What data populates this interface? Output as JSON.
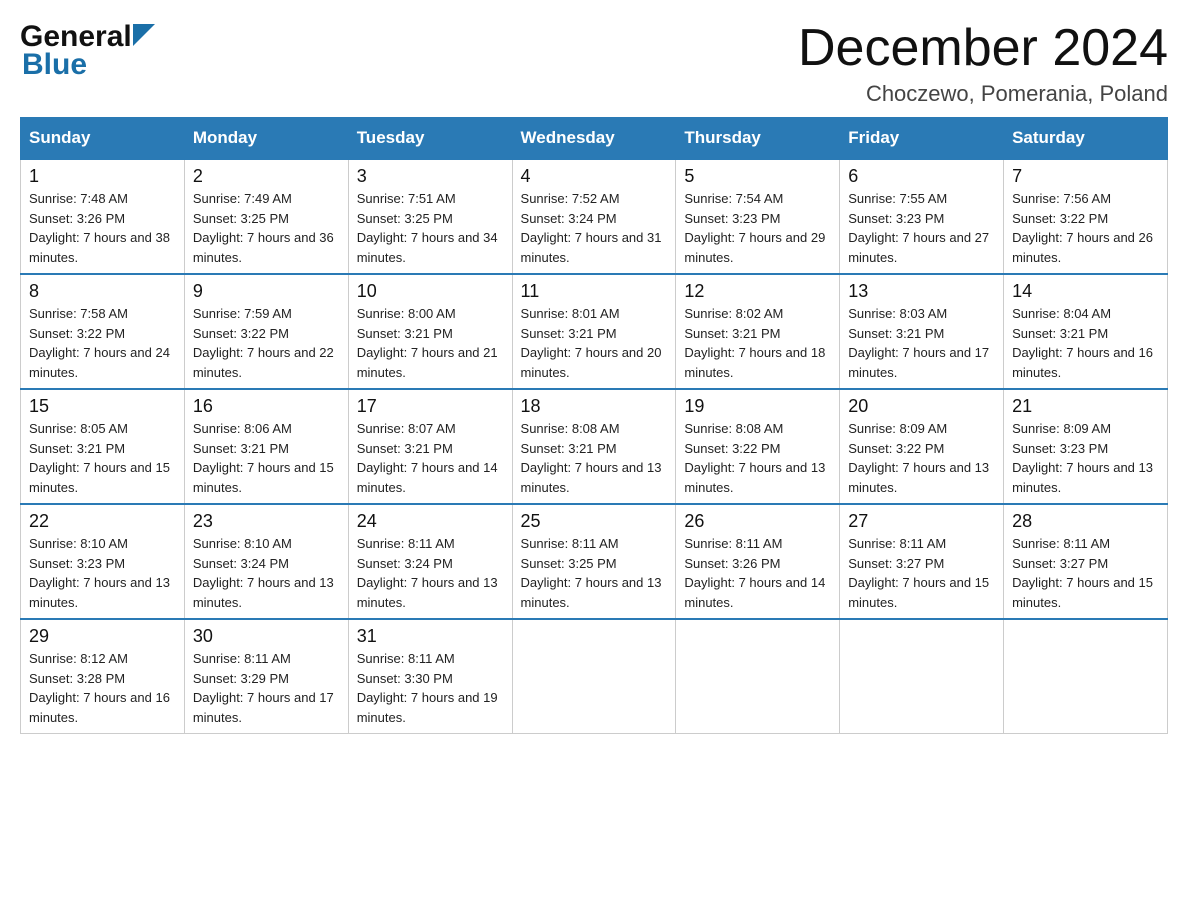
{
  "header": {
    "logo_general": "General",
    "logo_blue": "Blue",
    "month_title": "December 2024",
    "location": "Choczewo, Pomerania, Poland"
  },
  "days_of_week": [
    "Sunday",
    "Monday",
    "Tuesday",
    "Wednesday",
    "Thursday",
    "Friday",
    "Saturday"
  ],
  "weeks": [
    [
      {
        "day": "1",
        "sunrise": "Sunrise: 7:48 AM",
        "sunset": "Sunset: 3:26 PM",
        "daylight": "Daylight: 7 hours and 38 minutes."
      },
      {
        "day": "2",
        "sunrise": "Sunrise: 7:49 AM",
        "sunset": "Sunset: 3:25 PM",
        "daylight": "Daylight: 7 hours and 36 minutes."
      },
      {
        "day": "3",
        "sunrise": "Sunrise: 7:51 AM",
        "sunset": "Sunset: 3:25 PM",
        "daylight": "Daylight: 7 hours and 34 minutes."
      },
      {
        "day": "4",
        "sunrise": "Sunrise: 7:52 AM",
        "sunset": "Sunset: 3:24 PM",
        "daylight": "Daylight: 7 hours and 31 minutes."
      },
      {
        "day": "5",
        "sunrise": "Sunrise: 7:54 AM",
        "sunset": "Sunset: 3:23 PM",
        "daylight": "Daylight: 7 hours and 29 minutes."
      },
      {
        "day": "6",
        "sunrise": "Sunrise: 7:55 AM",
        "sunset": "Sunset: 3:23 PM",
        "daylight": "Daylight: 7 hours and 27 minutes."
      },
      {
        "day": "7",
        "sunrise": "Sunrise: 7:56 AM",
        "sunset": "Sunset: 3:22 PM",
        "daylight": "Daylight: 7 hours and 26 minutes."
      }
    ],
    [
      {
        "day": "8",
        "sunrise": "Sunrise: 7:58 AM",
        "sunset": "Sunset: 3:22 PM",
        "daylight": "Daylight: 7 hours and 24 minutes."
      },
      {
        "day": "9",
        "sunrise": "Sunrise: 7:59 AM",
        "sunset": "Sunset: 3:22 PM",
        "daylight": "Daylight: 7 hours and 22 minutes."
      },
      {
        "day": "10",
        "sunrise": "Sunrise: 8:00 AM",
        "sunset": "Sunset: 3:21 PM",
        "daylight": "Daylight: 7 hours and 21 minutes."
      },
      {
        "day": "11",
        "sunrise": "Sunrise: 8:01 AM",
        "sunset": "Sunset: 3:21 PM",
        "daylight": "Daylight: 7 hours and 20 minutes."
      },
      {
        "day": "12",
        "sunrise": "Sunrise: 8:02 AM",
        "sunset": "Sunset: 3:21 PM",
        "daylight": "Daylight: 7 hours and 18 minutes."
      },
      {
        "day": "13",
        "sunrise": "Sunrise: 8:03 AM",
        "sunset": "Sunset: 3:21 PM",
        "daylight": "Daylight: 7 hours and 17 minutes."
      },
      {
        "day": "14",
        "sunrise": "Sunrise: 8:04 AM",
        "sunset": "Sunset: 3:21 PM",
        "daylight": "Daylight: 7 hours and 16 minutes."
      }
    ],
    [
      {
        "day": "15",
        "sunrise": "Sunrise: 8:05 AM",
        "sunset": "Sunset: 3:21 PM",
        "daylight": "Daylight: 7 hours and 15 minutes."
      },
      {
        "day": "16",
        "sunrise": "Sunrise: 8:06 AM",
        "sunset": "Sunset: 3:21 PM",
        "daylight": "Daylight: 7 hours and 15 minutes."
      },
      {
        "day": "17",
        "sunrise": "Sunrise: 8:07 AM",
        "sunset": "Sunset: 3:21 PM",
        "daylight": "Daylight: 7 hours and 14 minutes."
      },
      {
        "day": "18",
        "sunrise": "Sunrise: 8:08 AM",
        "sunset": "Sunset: 3:21 PM",
        "daylight": "Daylight: 7 hours and 13 minutes."
      },
      {
        "day": "19",
        "sunrise": "Sunrise: 8:08 AM",
        "sunset": "Sunset: 3:22 PM",
        "daylight": "Daylight: 7 hours and 13 minutes."
      },
      {
        "day": "20",
        "sunrise": "Sunrise: 8:09 AM",
        "sunset": "Sunset: 3:22 PM",
        "daylight": "Daylight: 7 hours and 13 minutes."
      },
      {
        "day": "21",
        "sunrise": "Sunrise: 8:09 AM",
        "sunset": "Sunset: 3:23 PM",
        "daylight": "Daylight: 7 hours and 13 minutes."
      }
    ],
    [
      {
        "day": "22",
        "sunrise": "Sunrise: 8:10 AM",
        "sunset": "Sunset: 3:23 PM",
        "daylight": "Daylight: 7 hours and 13 minutes."
      },
      {
        "day": "23",
        "sunrise": "Sunrise: 8:10 AM",
        "sunset": "Sunset: 3:24 PM",
        "daylight": "Daylight: 7 hours and 13 minutes."
      },
      {
        "day": "24",
        "sunrise": "Sunrise: 8:11 AM",
        "sunset": "Sunset: 3:24 PM",
        "daylight": "Daylight: 7 hours and 13 minutes."
      },
      {
        "day": "25",
        "sunrise": "Sunrise: 8:11 AM",
        "sunset": "Sunset: 3:25 PM",
        "daylight": "Daylight: 7 hours and 13 minutes."
      },
      {
        "day": "26",
        "sunrise": "Sunrise: 8:11 AM",
        "sunset": "Sunset: 3:26 PM",
        "daylight": "Daylight: 7 hours and 14 minutes."
      },
      {
        "day": "27",
        "sunrise": "Sunrise: 8:11 AM",
        "sunset": "Sunset: 3:27 PM",
        "daylight": "Daylight: 7 hours and 15 minutes."
      },
      {
        "day": "28",
        "sunrise": "Sunrise: 8:11 AM",
        "sunset": "Sunset: 3:27 PM",
        "daylight": "Daylight: 7 hours and 15 minutes."
      }
    ],
    [
      {
        "day": "29",
        "sunrise": "Sunrise: 8:12 AM",
        "sunset": "Sunset: 3:28 PM",
        "daylight": "Daylight: 7 hours and 16 minutes."
      },
      {
        "day": "30",
        "sunrise": "Sunrise: 8:11 AM",
        "sunset": "Sunset: 3:29 PM",
        "daylight": "Daylight: 7 hours and 17 minutes."
      },
      {
        "day": "31",
        "sunrise": "Sunrise: 8:11 AM",
        "sunset": "Sunset: 3:30 PM",
        "daylight": "Daylight: 7 hours and 19 minutes."
      },
      null,
      null,
      null,
      null
    ]
  ]
}
